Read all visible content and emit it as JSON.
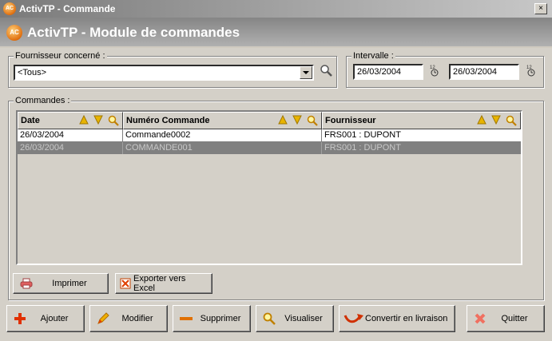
{
  "window": {
    "title": "ActivTP - Commande",
    "close_glyph": "×",
    "icon_text": "AC"
  },
  "header": {
    "title": "ActivTP - Module de commandes",
    "icon_text": "AC"
  },
  "supplier": {
    "label": "Fournisseur concerné :",
    "value": "<Tous>"
  },
  "interval": {
    "label": "Intervalle :",
    "from": "26/03/2004",
    "to": "26/03/2004",
    "calendar_glyph": "12"
  },
  "orders": {
    "label": "Commandes :",
    "columns": [
      "Date",
      "Numéro Commande",
      "Fournisseur"
    ],
    "rows": [
      [
        "26/03/2004",
        "Commande0002",
        "FRS001 : DUPONT"
      ],
      [
        "26/03/2004",
        "COMMANDE001",
        "FRS001 : DUPONT"
      ]
    ]
  },
  "table_actions": {
    "print": "Imprimer",
    "export": "Exporter vers Excel"
  },
  "actions": {
    "add": "Ajouter",
    "edit": "Modifier",
    "delete": "Supprimer",
    "view": "Visualiser",
    "convert": "Convertir en livraison",
    "quit": "Quitter"
  },
  "colors": {
    "accent": "#f0a000",
    "add": "#e03000",
    "selection": "#808080"
  }
}
